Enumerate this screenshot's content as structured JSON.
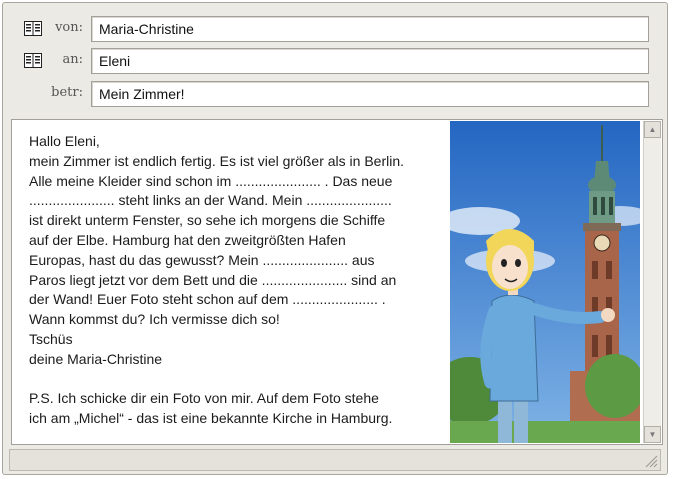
{
  "header": {
    "von": {
      "label": "von:",
      "value": "Maria-Christine",
      "icon": "address-book-icon"
    },
    "an": {
      "label": "an:",
      "value": "Eleni",
      "icon": "address-book-icon"
    },
    "betr": {
      "label": "betr:",
      "value": "Mein Zimmer!"
    }
  },
  "message": {
    "lines": [
      "Hallo Eleni,",
      "mein Zimmer ist endlich fertig. Es ist viel größer als in Berlin.",
      "Alle meine Kleider sind schon im ...................... . Das neue",
      "...................... steht links an der Wand. Mein ......................",
      "ist direkt unterm Fenster, so sehe ich morgens die Schiffe",
      "auf der Elbe. Hamburg hat den zweitgrößten Hafen",
      "Europas, hast du das gewusst? Mein ...................... aus",
      "Paros liegt jetzt vor dem Bett und die ......................  sind an",
      "der Wand! Euer Foto steht schon auf dem ...................... .",
      "Wann kommst du? Ich vermisse dich so!",
      "Tschüs",
      "deine Maria-Christine"
    ],
    "ps_lines": [
      "P.S. Ich schicke dir ein Foto von mir. Auf dem Foto stehe",
      "ich am „Michel“ - das ist eine bekannte Kirche in Hamburg."
    ]
  },
  "photo": {
    "subject": "girl-in-front-of-church-illustration"
  },
  "colors": {
    "window_bg": "#eceae4",
    "sky": "#2f74c9",
    "tower_green": "#5d8a76",
    "tower_brick": "#a9654a",
    "shirt_blue": "#6aa9dc"
  }
}
